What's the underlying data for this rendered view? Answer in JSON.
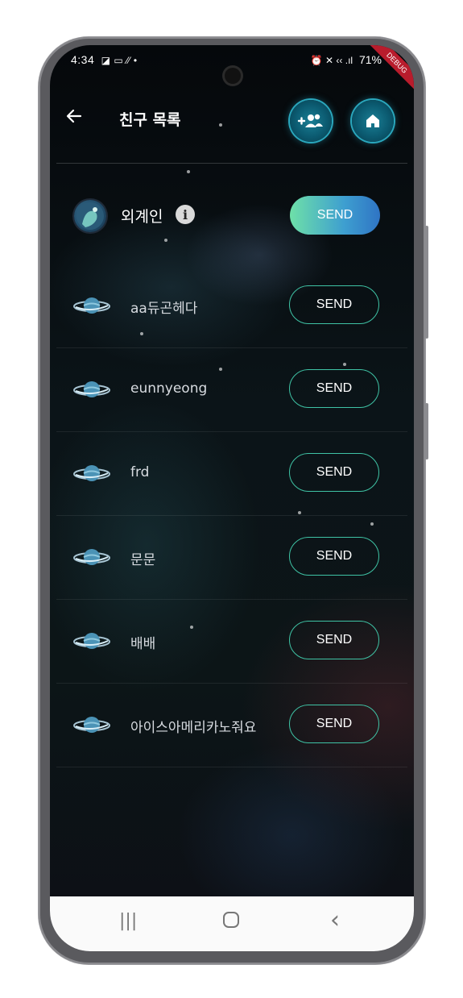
{
  "status_bar": {
    "time": "4:34",
    "left_icons": "◪ ▭ ⁄⁄ •",
    "right_icons": "⏰ ✕ ‹‹ .ıl",
    "battery": "71%",
    "debug_label": "DEBUG"
  },
  "header": {
    "back_icon": "arrow-left-icon",
    "title": "친구 목록",
    "add_friend_icon": "add-friend-icon",
    "home_icon": "home-icon"
  },
  "featured": {
    "name": "외계인",
    "info_glyph": "i",
    "send_label": "SEND"
  },
  "friends": [
    {
      "name": "aa듀곤헤다",
      "send_label": "SEND"
    },
    {
      "name": "eunnyeong",
      "send_label": "SEND"
    },
    {
      "name": "frd",
      "send_label": "SEND"
    },
    {
      "name": "문문",
      "send_label": "SEND"
    },
    {
      "name": "배배",
      "send_label": "SEND"
    },
    {
      "name": "아이스아메리카노줘요",
      "send_label": "SEND"
    }
  ],
  "nav": {
    "recents_glyph": "|||",
    "home_glyph": "▢",
    "back_glyph": "‹"
  },
  "colors": {
    "accent": "#3fc3a5",
    "send_gradient_start": "#6ee0a8",
    "send_gradient_end": "#2f74c4",
    "header_button": "#0b5a70"
  }
}
